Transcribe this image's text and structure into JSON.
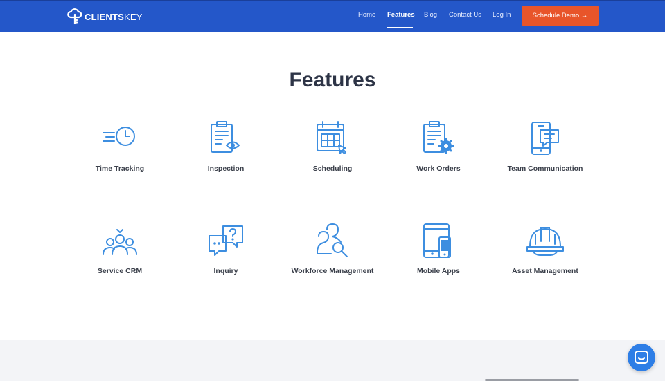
{
  "brand": {
    "logo_bold": "CLIENTS",
    "logo_light": "KEY"
  },
  "nav": {
    "links": [
      {
        "label": "Home",
        "active": false
      },
      {
        "label": "Features",
        "active": true
      },
      {
        "label": "Blog",
        "active": false
      },
      {
        "label": "Contact Us",
        "active": false
      },
      {
        "label": "Log In",
        "active": false
      }
    ],
    "cta": "Schedule Demo →"
  },
  "page": {
    "title": "Features"
  },
  "features": [
    {
      "label": "Time Tracking",
      "icon": "clock-icon"
    },
    {
      "label": "Inspection",
      "icon": "clipboard-eye-icon"
    },
    {
      "label": "Scheduling",
      "icon": "calendar-cursor-icon"
    },
    {
      "label": "Work Orders",
      "icon": "clipboard-gear-icon"
    },
    {
      "label": "Team Communication",
      "icon": "phone-chat-icon"
    },
    {
      "label": "Service CRM",
      "icon": "people-group-icon"
    },
    {
      "label": "Inquiry",
      "icon": "question-chat-icon"
    },
    {
      "label": "Workforce Management",
      "icon": "people-search-icon"
    },
    {
      "label": "Mobile Apps",
      "icon": "tablet-phone-icon"
    },
    {
      "label": "Asset Management",
      "icon": "hard-hat-icon"
    }
  ],
  "colors": {
    "header": "#2457c9",
    "cta": "#e8552a",
    "icon": "#3d8ee0",
    "title": "#2d3446",
    "chat": "#2e7ee6"
  }
}
